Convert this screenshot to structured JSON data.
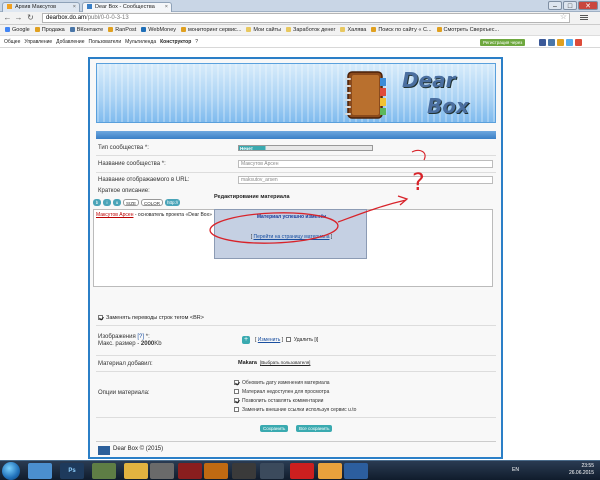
{
  "browser": {
    "tabs": [
      {
        "label": "Архив Максутов",
        "active": false
      },
      {
        "label": "Dear Box - Сообщества",
        "active": true
      }
    ],
    "window_controls": {
      "minimize": "–",
      "maximize": "□",
      "close": "✕"
    },
    "url_host": "dearbox.do.am",
    "url_path": "/publ/0-0-0-3-13"
  },
  "bookmarks": [
    {
      "label": "Google",
      "icon": "google-icon",
      "color": "#4285f4"
    },
    {
      "label": "Продажа",
      "icon": "bookmark-icon",
      "color": "#e0a020"
    },
    {
      "label": "ВКонтакте",
      "icon": "vk-icon",
      "color": "#4a76a8"
    },
    {
      "label": "RanPost",
      "icon": "bookmark-icon",
      "color": "#e0a020"
    },
    {
      "label": "WebMoney",
      "icon": "webmoney-icon",
      "color": "#1f6fb8"
    },
    {
      "label": "мониторинг сервис...",
      "icon": "bookmark-icon",
      "color": "#e0a020"
    },
    {
      "label": "Мои сайты",
      "icon": "folder-icon",
      "color": "#e8c860"
    },
    {
      "label": "Заработок денег",
      "icon": "folder-icon",
      "color": "#e8c860"
    },
    {
      "label": "Халява",
      "icon": "folder-icon",
      "color": "#e8c860"
    },
    {
      "label": "Поиск по сайту « С...",
      "icon": "bookmark-icon",
      "color": "#e0a020"
    },
    {
      "label": "Смотреть Сверхъес...",
      "icon": "bookmark-icon",
      "color": "#e0a020"
    }
  ],
  "sitebar": {
    "links": [
      "Общее",
      "Управление",
      "Добавление",
      "Пользователи",
      "Мультиленда",
      "Конструктор",
      "?"
    ],
    "register": "Регистрация через"
  },
  "banner": {
    "logo_line1": "Dear",
    "logo_line2": "Box"
  },
  "form": {
    "type_label": "Тип сообщества *:",
    "type_value": "Нечет",
    "name_label": "Название сообщества *:",
    "name_value": "Максутов Арсен",
    "url_label": "Название отображаемого в URL:",
    "url_value": "maksutov_arsen",
    "desc_label": "Краткое описание:",
    "toolbar": {
      "size": "SIZE",
      "color": "COLOR",
      "http": "http://"
    },
    "desc_text_link": "Максутов Арсен",
    "desc_text_rest": " - основатель проекта «Dear Box»",
    "popup_header": "Редактирование материала",
    "popup_title": "Материал успешно изменён",
    "popup_link_prefix": "[ ",
    "popup_link": "Перейти на страницу материала",
    "popup_link_suffix": " ]",
    "br_label": "Заменять переводы строк тегом <BR>",
    "image_label": "Изображения",
    "image_help": "[?]",
    "image_max_prefix": "Макс. размер - ",
    "image_max_value": "2000",
    "image_max_unit": "Kb",
    "image_change": "Изменить",
    "image_delete": "Удалить",
    "added_label": "Материал добавил:",
    "added_user": "Makara",
    "added_change": "Выбрать пользователя",
    "options_label": "Опции материала:",
    "options": [
      {
        "label": "Обновить дату изменения материала",
        "checked": true
      },
      {
        "label": "Материал недоступен для просмотра",
        "checked": false
      },
      {
        "label": "Позволить оставлять комментарии",
        "checked": true
      },
      {
        "label": "Заменить внешние ссылки используя сервис u.to",
        "checked": false
      }
    ],
    "save": "Сохранить",
    "preview": "Все сохранить"
  },
  "footer": {
    "copyright": "Dear Box © (2015)"
  },
  "taskbar": {
    "lang": "EN",
    "time": "23:55",
    "date": "26.06.2015"
  },
  "annotation": {
    "mark": "?"
  }
}
